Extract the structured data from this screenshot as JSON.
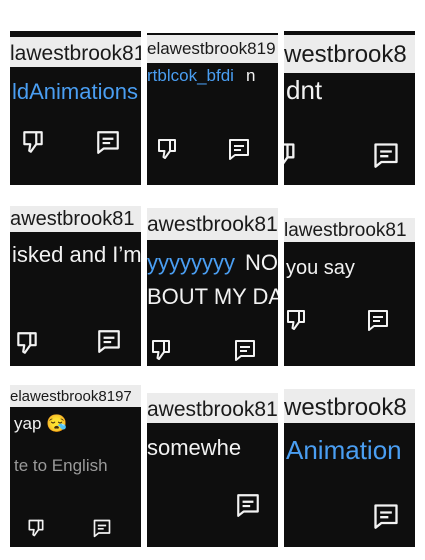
{
  "tiles": [
    {
      "username": "lawestbrook81",
      "message": "ldAnimations",
      "message_is_link": true
    },
    {
      "username": "elawestbrook819",
      "message": "rtblcok_bfdi",
      "message_suffix": "n",
      "message_is_link": true
    },
    {
      "username": "westbrook8",
      "message": "dnt"
    },
    {
      "username": "awestbrook81",
      "message": "isked and I’m"
    },
    {
      "username": "awestbrook81",
      "message": "yyyyyyyy",
      "message_suffix": "NO",
      "message_is_link": true,
      "message_line2": "BOUT MY DA"
    },
    {
      "username": "lawestbrook81",
      "message": "you say"
    },
    {
      "username": "elawestbrook8197",
      "message": "yap 😪",
      "subtext": "te to English"
    },
    {
      "username": "awestbrook81",
      "message": "somewhe"
    },
    {
      "username": "westbrook8",
      "message": "Animation",
      "message_is_link": true
    }
  ],
  "icons": {
    "dislike": "thumbs-down-icon",
    "reply": "comment-icon"
  },
  "colors": {
    "tile_bg": "#0e0e0e",
    "text": "#f2f2f2",
    "link": "#4a9ef2",
    "username_bg": "#ececec"
  }
}
